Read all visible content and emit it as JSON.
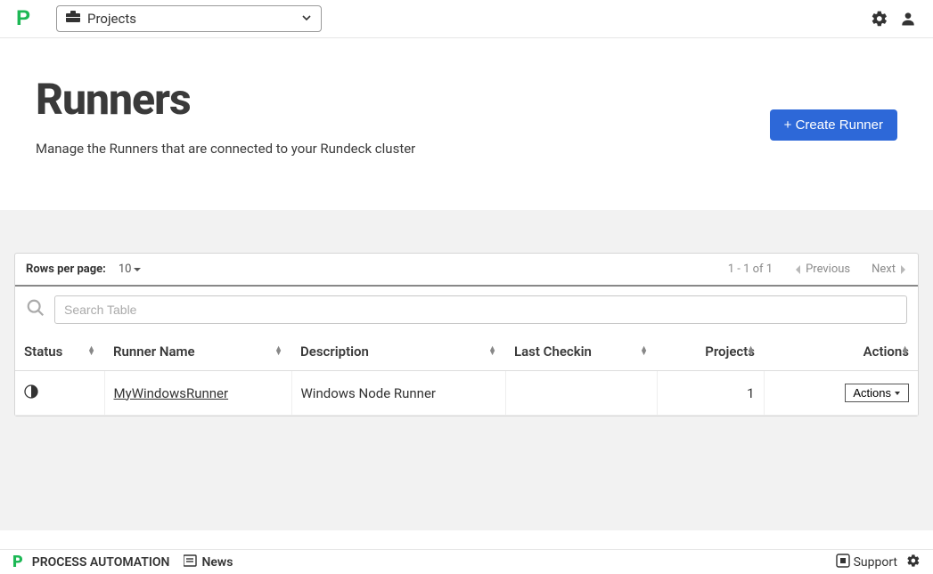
{
  "topbar": {
    "projects_label": "Projects"
  },
  "header": {
    "title": "Runners",
    "subtitle": "Manage the Runners that are connected to your Rundeck cluster",
    "create_label": "+ Create Runner"
  },
  "table": {
    "rows_per_page_label": "Rows per page:",
    "rows_per_page_value": "10",
    "range_text": "1 - 1 of 1",
    "prev_label": "Previous",
    "next_label": "Next",
    "search_placeholder": "Search Table",
    "columns": {
      "status": "Status",
      "runner_name": "Runner Name",
      "description": "Description",
      "last_checkin": "Last Checkin",
      "projects": "Projects",
      "actions": "Actions"
    },
    "rows": [
      {
        "status_icon": "half-circle",
        "runner_name": "MyWindowsRunner",
        "description": "Windows Node Runner",
        "last_checkin": "",
        "projects": "1",
        "actions_label": "Actions"
      }
    ]
  },
  "footer": {
    "brand": "PROCESS AUTOMATION",
    "news_label": "News",
    "support_label": "Support"
  }
}
